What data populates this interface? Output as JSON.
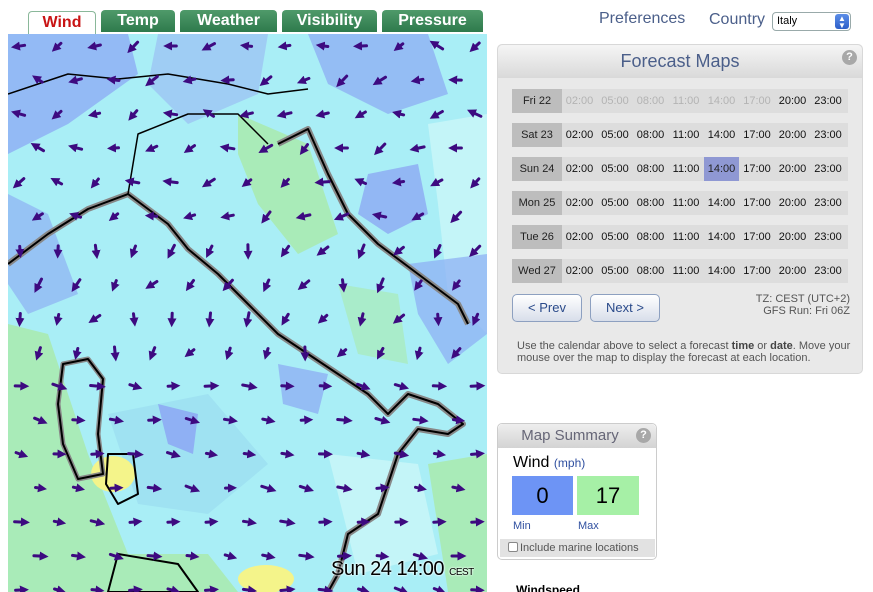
{
  "tabs": [
    {
      "label": "Wind",
      "active": true
    },
    {
      "label": "Temp",
      "active": false
    },
    {
      "label": "Weather",
      "active": false
    },
    {
      "label": "Visibility",
      "active": false
    },
    {
      "label": "Pressure",
      "active": false
    }
  ],
  "header": {
    "preferences": "Preferences",
    "country_label": "Country",
    "country_value": "Italy"
  },
  "map": {
    "stamp_day": "Sun",
    "stamp_date": "24",
    "stamp_time": "14:00",
    "stamp_tz": "CEST"
  },
  "forecast": {
    "title": "Forecast Maps",
    "help": "?",
    "times": [
      "02:00",
      "05:00",
      "08:00",
      "11:00",
      "14:00",
      "17:00",
      "20:00",
      "23:00"
    ],
    "rows": [
      {
        "day": "Fri 22",
        "past_count": 6,
        "selected_index": -1
      },
      {
        "day": "Sat 23",
        "past_count": 0,
        "selected_index": -1
      },
      {
        "day": "Sun 24",
        "past_count": 0,
        "selected_index": 4
      },
      {
        "day": "Mon 25",
        "past_count": 0,
        "selected_index": -1
      },
      {
        "day": "Tue 26",
        "past_count": 0,
        "selected_index": -1
      },
      {
        "day": "Wed 27",
        "past_count": 0,
        "selected_index": -1
      }
    ],
    "prev_label": "< Prev",
    "next_label": "Next >",
    "tz_line": "TZ: CEST (UTC+2)",
    "gfs_line": "GFS Run: Fri 06Z",
    "hint_pre": "Use the calendar above to select a forecast ",
    "hint_time": "time",
    "hint_or": " or ",
    "hint_date": "date",
    "hint_post": ". Move your mouse over the map to display the forecast at each location."
  },
  "summary": {
    "title": "Map Summary",
    "help": "?",
    "metric": "Wind",
    "unit": "(mph)",
    "min_value": "0",
    "max_value": "17",
    "min_label": "Min",
    "max_label": "Max",
    "marine_label": "Include marine locations"
  },
  "footer": {
    "windspeed": "Windspeed"
  },
  "colors": {
    "tab_green": "#3a8a58",
    "active_tab_text": "#c81414",
    "selected_cell": "#8f98d3",
    "min_box": "#6d94f5",
    "max_box": "#a6f0a6",
    "arrow": "#3d0a80"
  }
}
